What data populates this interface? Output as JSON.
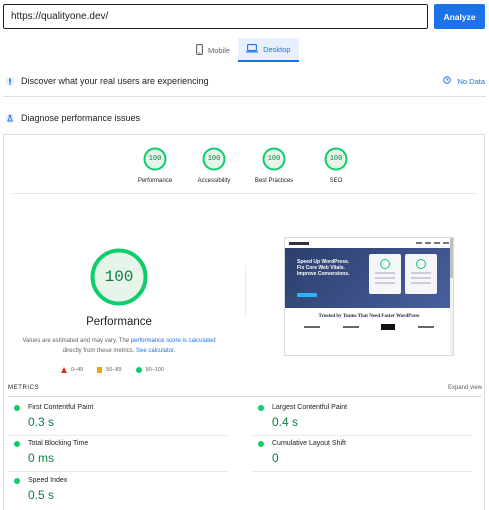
{
  "url_bar": {
    "value": "https://qualityone.dev/",
    "analyze_label": "Analyze"
  },
  "device_tabs": [
    {
      "label": "Mobile",
      "icon": "phone-icon",
      "active": false
    },
    {
      "label": "Desktop",
      "icon": "laptop-icon",
      "active": true
    }
  ],
  "field_section": {
    "title": "Discover what your real users are experiencing",
    "no_data_label": "No Data"
  },
  "lab_section": {
    "title": "Diagnose performance issues"
  },
  "categories": [
    {
      "score": "100",
      "label": "Performance"
    },
    {
      "score": "100",
      "label": "Accessibility"
    },
    {
      "score": "100",
      "label": "Best Practices"
    },
    {
      "score": "100",
      "label": "SEO"
    }
  ],
  "performance": {
    "score": "100",
    "title": "Performance",
    "note_part1": "Values are estimated and may vary. The ",
    "note_link1": "performance score is calculated",
    "note_part2": " directly from these metrics. ",
    "note_link2": "See calculator."
  },
  "legend": [
    {
      "range": "0–49",
      "color": "#d93025"
    },
    {
      "range": "50–89",
      "color": "#f2a600"
    },
    {
      "range": "90–100",
      "color": "#0cce6b"
    }
  ],
  "thumbnail": {
    "headline": "Speed Up WordPress. Fix Core Web Vitals. Improve Conversions.",
    "trust_line": "Trusted by Teams That Need Faster WordPress"
  },
  "metrics": {
    "header": "METRICS",
    "expand_label": "Expand view",
    "items": [
      {
        "name": "First Contentful Paint",
        "value": "0.3 s"
      },
      {
        "name": "Largest Contentful Paint",
        "value": "0.4 s"
      },
      {
        "name": "Total Blocking Time",
        "value": "0 ms"
      },
      {
        "name": "Cumulative Layout Shift",
        "value": "0"
      },
      {
        "name": "Speed Index",
        "value": "0.5 s"
      }
    ]
  },
  "colors": {
    "accent": "#1a73e8",
    "pass": "#0cce6b",
    "pass_text": "#0b8043",
    "pass_fill": "#e6f4ea"
  }
}
